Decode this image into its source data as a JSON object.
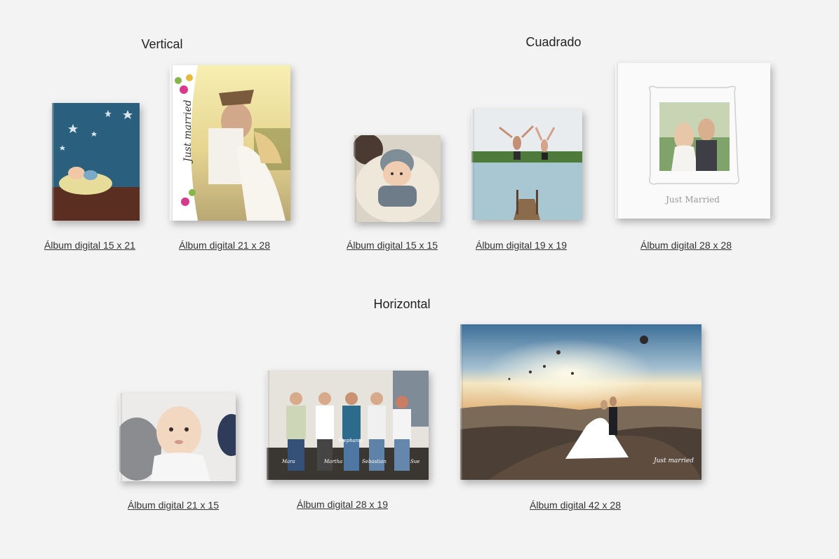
{
  "sections": {
    "vertical": {
      "title": "Vertical"
    },
    "cuadrado": {
      "title": "Cuadrado"
    },
    "horizontal": {
      "title": "Horizontal"
    }
  },
  "albums": {
    "v15x21": {
      "label": "Álbum digital 15 x 21"
    },
    "v21x28": {
      "label": "Álbum digital 21 x 28",
      "cover_text": "Just married"
    },
    "s15x15": {
      "label": "Álbum digital 15 x 15"
    },
    "s19x19": {
      "label": "Álbum digital 19 x 19"
    },
    "s28x28": {
      "label": "Álbum digital 28 x 28",
      "cover_text": "Just Married"
    },
    "h21x15": {
      "label": "Álbum digital 21 x 15"
    },
    "h28x19": {
      "label": "Álbum digital 28 x 19",
      "names": [
        "Mara",
        "Martha",
        "Stephanie",
        "Sebastian",
        "Sue"
      ]
    },
    "h42x28": {
      "label": "Álbum digital 42 x 28",
      "cover_text": "Just married"
    }
  },
  "colors": {
    "background": "#f3f3f4",
    "link": "#333333"
  }
}
